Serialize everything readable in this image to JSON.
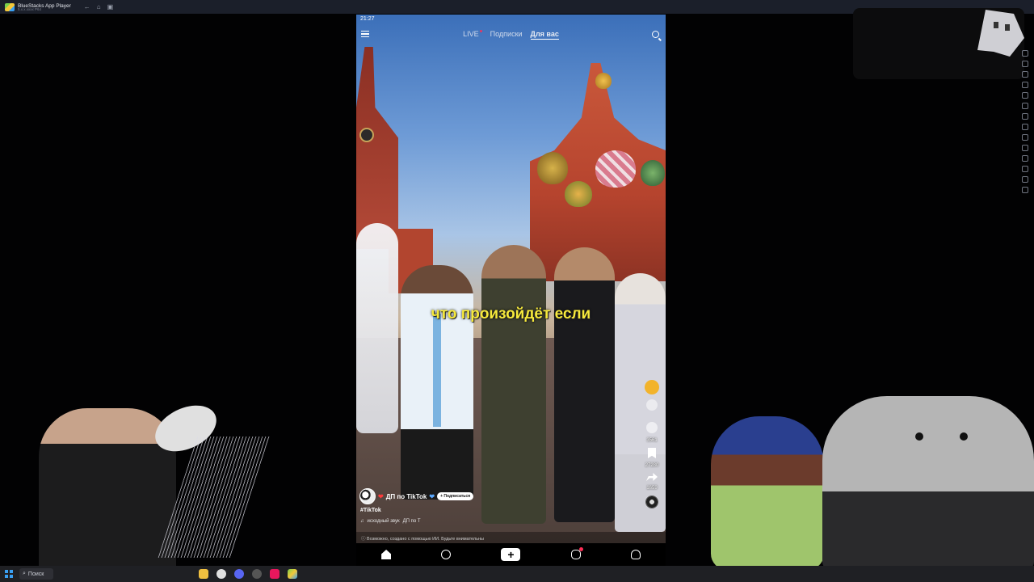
{
  "window": {
    "app_title": "BlueStacks App Player",
    "app_subtitle": "5.x.x.xxxx P64"
  },
  "phone": {
    "time": "21:27",
    "top_tabs": [
      {
        "label": "LIVE"
      },
      {
        "label": "Подписки"
      },
      {
        "label": "Для вас"
      }
    ],
    "caption": "что произойдёт если",
    "author": "ДП по TikTok",
    "follow_label": "Подписаться",
    "hashtag": "#TikTok",
    "sound": "исходный звук",
    "sound_author": "ДП по Т",
    "ai_note": "Возможно, создано с помощью ИИ. Будьте внимательны",
    "actions": {
      "comments": "3561",
      "saves": "27280",
      "shares": "1659"
    }
  },
  "taskbar": {
    "search_placeholder": "Поиск"
  },
  "colors": {
    "caption": "#f6e93c",
    "accent_red": "#ff2d55"
  }
}
